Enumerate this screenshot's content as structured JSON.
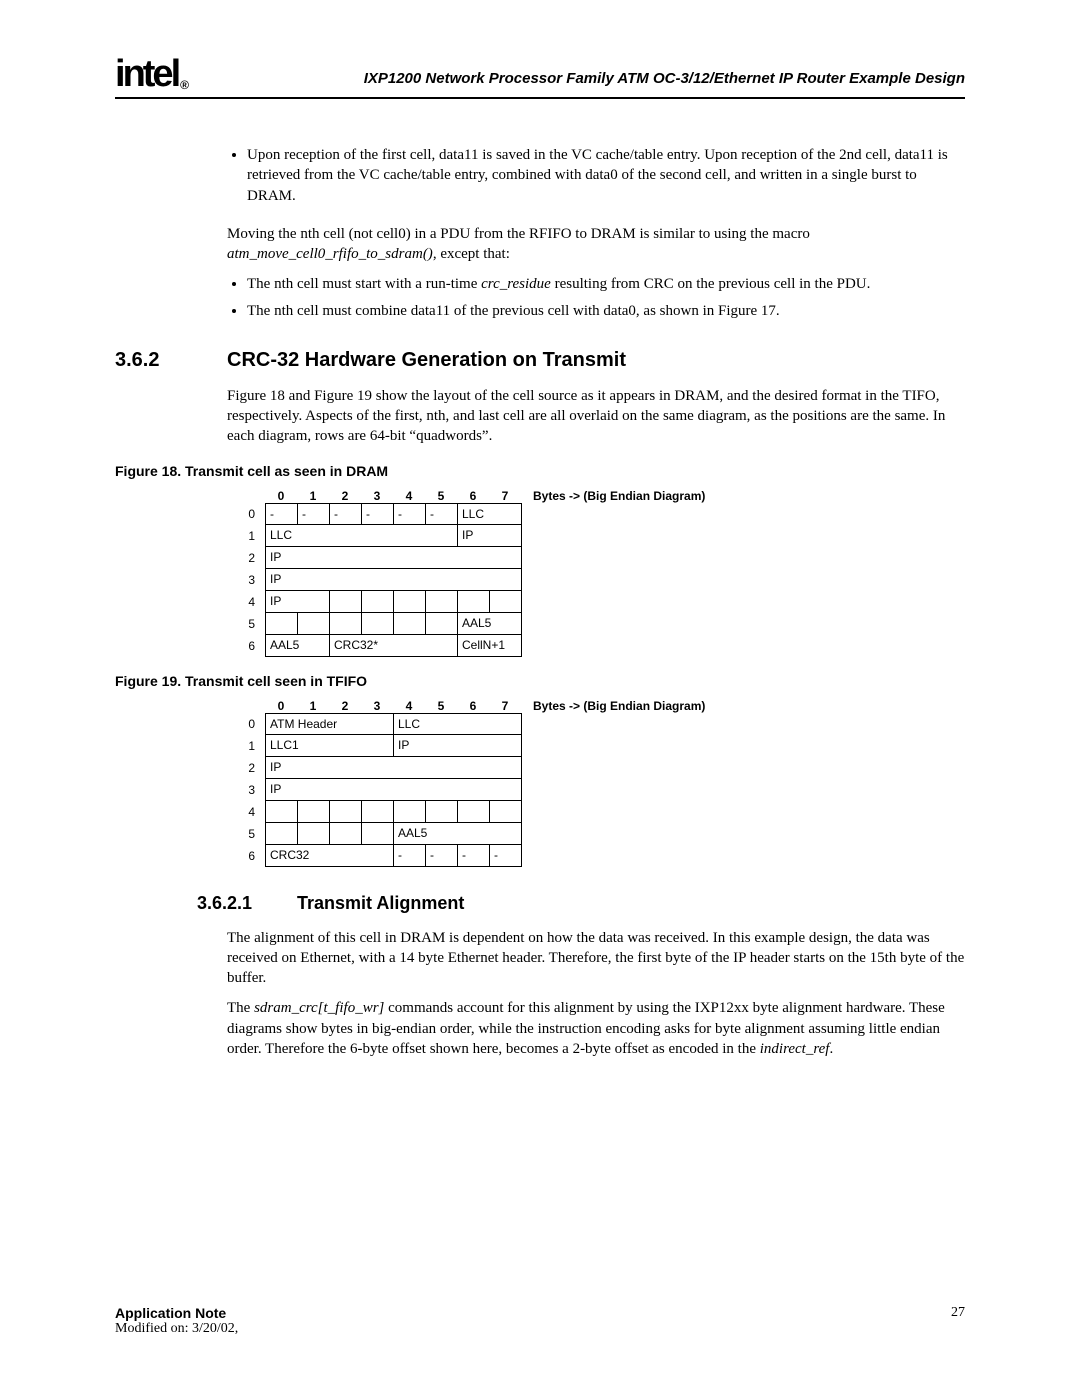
{
  "logo_text": "intel",
  "logo_reg": "®",
  "document_title": "IXP1200 Network Processor Family ATM OC-3/12/Ethernet IP Router Example Design",
  "bullet1": "Upon reception of the first cell, data11 is saved in the VC cache/table entry. Upon reception of the 2nd cell, data11 is retrieved from the VC cache/table entry, combined with data0 of the second cell, and written in a single burst to DRAM.",
  "para1a": "Moving the nth cell (not cell0) in a PDU from the RFIFO to DRAM is similar to using the macro ",
  "para1b": "atm_move_cell0_rfifo_to_sdram()",
  "para1c": ", except that:",
  "bullet2a": "The nth cell must start with a run-time ",
  "bullet2b": "crc_residue",
  "bullet2c": " resulting from CRC on the previous cell in the PDU.",
  "bullet3": "The nth cell must combine data11 of the previous cell with data0, as shown in Figure 17.",
  "sec362_num": "3.6.2",
  "sec362_title": "CRC-32 Hardware Generation on Transmit",
  "para2": "Figure 18 and Figure 19 show the layout of the cell source as it appears in DRAM, and the desired format in the TIFO, respectively. Aspects of the first, nth, and last cell are all overlaid on the same diagram, as the positions are the same. In each diagram, rows are 64-bit “quadwords”.",
  "fig18_caption": "Figure 18. Transmit cell as seen in DRAM",
  "fig19_caption": "Figure 19. Transmit cell seen in TFIFO",
  "byte_legend": "Bytes -> (Big Endian Diagram)",
  "col0": "0",
  "col1": "1",
  "col2": "2",
  "col3": "3",
  "col4": "4",
  "col5": "5",
  "col6": "6",
  "col7": "7",
  "r0": "0",
  "r1": "1",
  "r2": "2",
  "r3": "3",
  "r4": "4",
  "r5": "5",
  "r6": "6",
  "diag18": {
    "dash": "-",
    "LLC": "LLC",
    "IP": "IP",
    "AAL5": "AAL5",
    "CRC32star": "CRC32*",
    "CellN1": "CellN+1"
  },
  "diag19": {
    "ATMHeader": "ATM Header",
    "LLC": "LLC",
    "LLC1": "LLC1",
    "IP": "IP",
    "AAL5": "AAL5",
    "CRC32": "CRC32",
    "dash": "-"
  },
  "sec3621_num": "3.6.2.1",
  "sec3621_title": "Transmit Alignment",
  "para3": "The alignment of this cell in DRAM is dependent on how the data was received. In this example design, the data was received on Ethernet, with a 14 byte Ethernet header. Therefore, the first byte of the IP header starts on the 15th byte of the buffer.",
  "para4a": "The ",
  "para4b": "sdram_crc[t_fifo_wr]",
  "para4c": " commands account for this alignment by using the IXP12xx byte alignment hardware. These diagrams show bytes in big-endian order, while the instruction encoding asks for byte alignment assuming little endian order. Therefore the 6-byte offset shown here, becomes a 2-byte offset as encoded in the ",
  "para4d": "indirect_ref",
  "para4e": ".",
  "footer_appnote": "Application Note",
  "footer_pageno": "27",
  "footer_modified": "Modified on: 3/20/02,"
}
